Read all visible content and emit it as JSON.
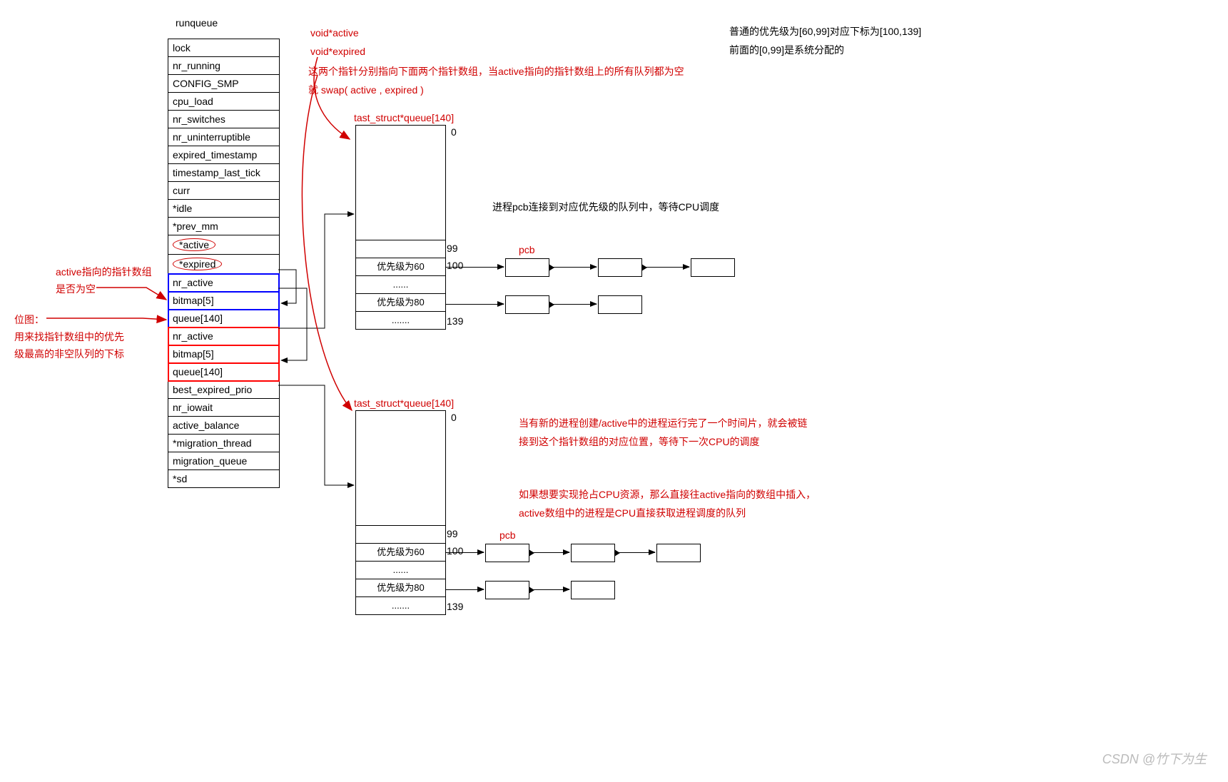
{
  "title": "runqueue",
  "fields": [
    "lock",
    "nr_running",
    "CONFIG_SMP",
    "cpu_load",
    "nr_switches",
    "nr_uninterruptible",
    "expired_timestamp",
    "timestamp_last_tick",
    "curr",
    "*idle",
    "*prev_mm"
  ],
  "active_field": "*active",
  "expired_field": "*expired",
  "prio_group": [
    "nr_active",
    "bitmap[5]",
    "queue[140]"
  ],
  "tail_fields": [
    "best_expired_prio",
    "nr_iowait",
    "active_balance",
    "*migration_thread",
    "migration_queue",
    "*sd"
  ],
  "notes": {
    "top1": "void*active",
    "top2": "void*expired",
    "top3": "这两个指针分别指向下面两个指针数组，当active指向的指针数组上的所有队列都为空",
    "top4": "就 swap( active , expired )",
    "struct_label": "tast_struct*queue[140]",
    "idx0": "0",
    "idx99": "99",
    "idx100": "100",
    "idx139": "139",
    "prio60": "优先级为60",
    "prio80": "优先级为80",
    "dots1": "......",
    "dots2": ".......",
    "pcb": "pcb",
    "mid": "进程pcb连接到对应优先级的队列中，等待CPU调度",
    "left1": "active指向的指针数组",
    "left1b": "是否为空",
    "left2": "位图：",
    "left2b": "用来找指针数组中的优先",
    "left2c": "级最高的非空队列的下标",
    "r1": "普通的优先级为[60,99]对应下标为[100,139]",
    "r2": "前面的[0,99]是系统分配的",
    "b1": "当有新的进程创建/active中的进程运行完了一个时间片，就会被链",
    "b1b": "接到这个指针数组的对应位置，等待下一次CPU的调度",
    "b2": "如果想要实现抢占CPU资源，那么直接往active指向的数组中插入，",
    "b2b": "active数组中的进程是CPU直接获取进程调度的队列"
  },
  "watermark": "CSDN @竹下为生"
}
